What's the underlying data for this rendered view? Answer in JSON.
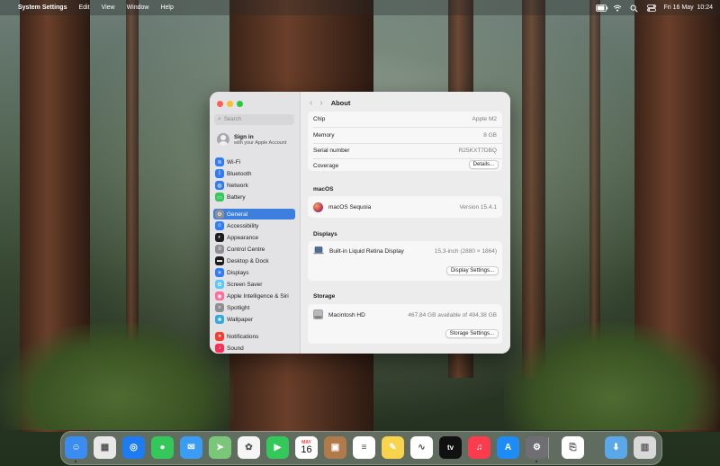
{
  "menubar": {
    "apple": "",
    "app_name": "System Settings",
    "menus": [
      "Edit",
      "View",
      "Window",
      "Help"
    ],
    "clock": "Fri 16 May  10:24",
    "icons": [
      "battery-icon",
      "wifi-icon",
      "search-icon",
      "control-center-icon"
    ]
  },
  "window": {
    "title": "About",
    "search_placeholder": "Search",
    "account": {
      "title": "Sign in",
      "subtitle": "with your Apple Account"
    },
    "sidebar": [
      {
        "label": "Wi-Fi",
        "color": "#2f7cf6",
        "icon": "wifi-icon"
      },
      {
        "label": "Bluetooth",
        "color": "#2f7cf6",
        "icon": "bluetooth-icon"
      },
      {
        "label": "Network",
        "color": "#2f7cf6",
        "icon": "globe-icon"
      },
      {
        "label": "Battery",
        "color": "#34c759",
        "icon": "battery-icon"
      },
      {
        "label": "General",
        "color": "#8e8e93",
        "icon": "gear-icon",
        "selected": true
      },
      {
        "label": "Accessibility",
        "color": "#2f7cf6",
        "icon": "accessibility-icon"
      },
      {
        "label": "Appearance",
        "color": "#1d1d1f",
        "icon": "appearance-icon"
      },
      {
        "label": "Control Centre",
        "color": "#8e8e93",
        "icon": "control-centre-icon"
      },
      {
        "label": "Desktop & Dock",
        "color": "#1d1d1f",
        "icon": "dock-icon"
      },
      {
        "label": "Displays",
        "color": "#2f7cf6",
        "icon": "display-icon"
      },
      {
        "label": "Screen Saver",
        "color": "#5ac8fa",
        "icon": "screensaver-icon"
      },
      {
        "label": "Apple Intelligence & Siri",
        "color": "#ff6b9a",
        "icon": "siri-icon"
      },
      {
        "label": "Spotlight",
        "color": "#8e8e93",
        "icon": "spotlight-icon"
      },
      {
        "label": "Wallpaper",
        "color": "#34aadc",
        "icon": "wallpaper-icon"
      },
      {
        "label": "Notifications",
        "color": "#ff3b30",
        "icon": "notifications-icon"
      },
      {
        "label": "Sound",
        "color": "#ff2d55",
        "icon": "sound-icon"
      }
    ],
    "about": {
      "specs": [
        {
          "key": "Chip",
          "value": "Apple M2"
        },
        {
          "key": "Memory",
          "value": "8 GB"
        },
        {
          "key": "Serial number",
          "value": "R25KXT7DBQ"
        },
        {
          "key": "Coverage",
          "value": ""
        }
      ],
      "details_button": "Details...",
      "macos_header": "macOS",
      "macos_name": "macOS Sequoia",
      "macos_version": "Version 15.4.1",
      "displays_header": "Displays",
      "display_name": "Built-in Liquid Retina Display",
      "display_spec": "15,3-inch (2880 × 1864)",
      "display_settings_button": "Display Settings...",
      "storage_header": "Storage",
      "disk_name": "Macintosh HD",
      "disk_info": "467,84 GB available of 494,38 GB",
      "storage_settings_button": "Storage Settings..."
    }
  },
  "dock": {
    "calendar_month": "MAY",
    "calendar_day": "16",
    "appletv_label": "tv",
    "apps": [
      {
        "name": "finder-icon",
        "color": "#3b8cf0"
      },
      {
        "name": "launchpad-icon",
        "color": "#e8e8e8"
      },
      {
        "name": "safari-icon",
        "color": "#1e7cf2"
      },
      {
        "name": "messages-icon",
        "color": "#34c759"
      },
      {
        "name": "mail-icon",
        "color": "#3b9cf6"
      },
      {
        "name": "maps-icon",
        "color": "#7bc77a"
      },
      {
        "name": "photos-icon",
        "color": "#f5f5f5"
      },
      {
        "name": "facetime-icon",
        "color": "#34c759"
      },
      {
        "name": "calendar-icon",
        "color": "#ffffff"
      },
      {
        "name": "contacts-icon",
        "color": "#b07a4a"
      },
      {
        "name": "reminders-icon",
        "color": "#ffffff"
      },
      {
        "name": "notes-icon",
        "color": "#f7d44c"
      },
      {
        "name": "freeform-icon",
        "color": "#ffffff"
      },
      {
        "name": "appletv-icon",
        "color": "#111111"
      },
      {
        "name": "music-icon",
        "color": "#fa3c4c"
      },
      {
        "name": "appstore-icon",
        "color": "#1d8cf7"
      },
      {
        "name": "system-settings-icon",
        "color": "#6e6e73"
      },
      {
        "name": "preview-icon",
        "color": "#ffffff"
      },
      {
        "name": "downloads-folder-icon",
        "color": "#5aa8e8"
      },
      {
        "name": "trash-icon",
        "color": "#d9d9d9"
      }
    ]
  }
}
